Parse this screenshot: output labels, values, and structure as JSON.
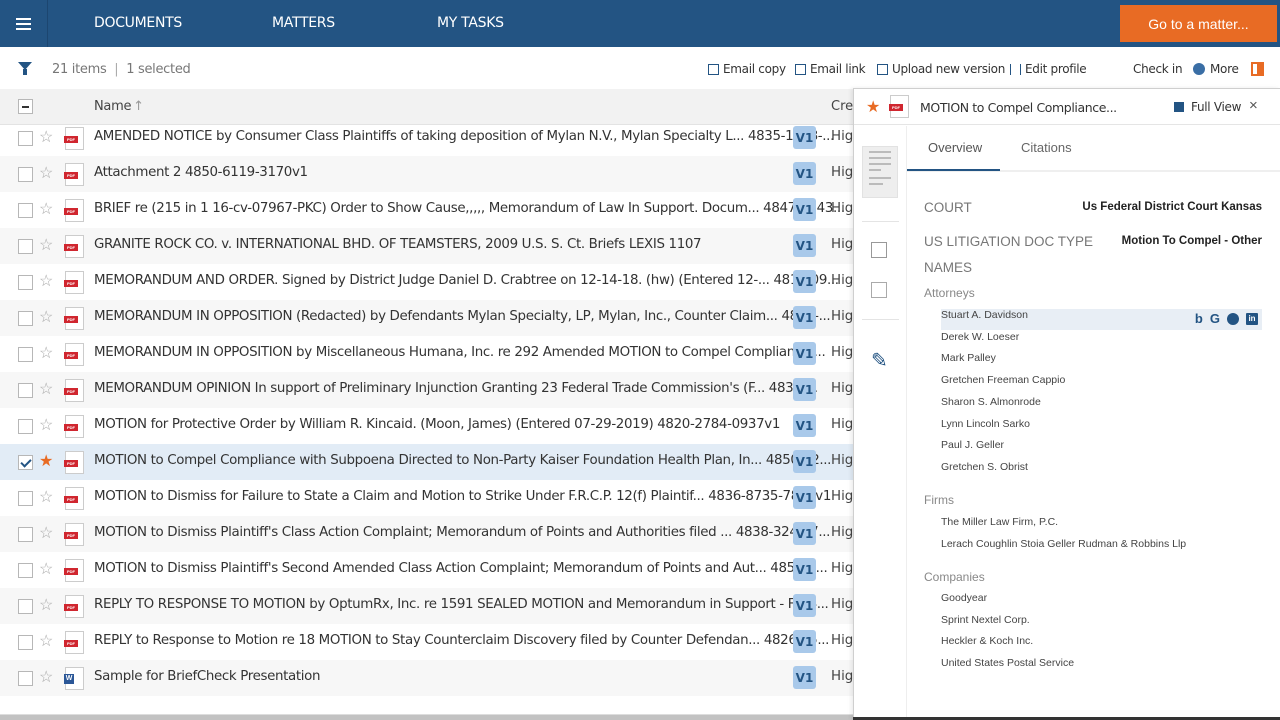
{
  "nav": {
    "menu_icon": "hamburger-icon",
    "links": [
      "DOCUMENTS",
      "MATTERS",
      "MY TASKS"
    ],
    "goto_button": "Go to a matter..."
  },
  "toolbar": {
    "filter_icon": "filter-icon",
    "item_count": "21 items",
    "separator": "|",
    "selected_count": "1 selected",
    "actions": [
      {
        "label": "Email copy",
        "icon": "envelope-icon"
      },
      {
        "label": "Email link",
        "icon": "link-doc-icon"
      },
      {
        "label": "Upload new version",
        "icon": "upload-icon"
      },
      {
        "label": "Edit profile",
        "icon": "edit-profile-icon"
      },
      {
        "label": "Check in",
        "icon": ""
      },
      {
        "label": "More",
        "icon": "more-icon"
      }
    ],
    "panel_toggle_icon": "panel-toggle-icon"
  },
  "table": {
    "columns": {
      "name": "Name",
      "name_sort": "↑",
      "created": "Crea"
    },
    "rows": [
      {
        "title": "AMENDED NOTICE by Consumer Class Plaintiffs of taking deposition of Mylan N.V., Mylan Specialty L... 4835-1488-...",
        "type": "pdf",
        "version": "V1",
        "col": "High",
        "checked": false,
        "starred": false
      },
      {
        "title": "Attachment 2 4850-6119-3170v1",
        "type": "pdf",
        "version": "V1",
        "col": "High",
        "checked": false,
        "starred": false
      },
      {
        "title": "BRIEF re (215 in 1 16-cv-07967-PKC) Order to Show Cause,,,,, Memorandum of Law In Support. Docum... 4847-7143...",
        "type": "pdf",
        "version": "V1",
        "col": "High",
        "checked": false,
        "starred": false
      },
      {
        "title": "GRANITE ROCK CO. v. INTERNATIONAL BHD. OF TEAMSTERS, 2009 U.S. S. Ct. Briefs LEXIS 1107",
        "type": "pdf",
        "version": "V1",
        "col": "High",
        "checked": false,
        "starred": false
      },
      {
        "title": "MEMORANDUM AND ORDER. Signed by District Judge Daniel D. Crabtree on 12-14-18. (hw) (Entered 12-... 4818-09...",
        "type": "pdf",
        "version": "V1",
        "col": "High",
        "checked": false,
        "starred": false
      },
      {
        "title": "MEMORANDUM IN OPPOSITION (Redacted) by Defendants Mylan Specialty, LP, Mylan, Inc., Counter Claim... 4811-...",
        "type": "pdf",
        "version": "V1",
        "col": "High",
        "checked": false,
        "starred": false
      },
      {
        "title": "MEMORANDUM IN OPPOSITION by Miscellaneous Humana, Inc. re 292 Amended MOTION to Compel Complianc......",
        "type": "pdf",
        "version": "V1",
        "col": "High",
        "checked": false,
        "starred": false
      },
      {
        "title": "MEMORANDUM OPINION In support of Preliminary Injunction Granting 23 Federal Trade Commission's (F... 4831-...",
        "type": "pdf",
        "version": "V1",
        "col": "High",
        "checked": false,
        "starred": false
      },
      {
        "title": "MOTION for Protective Order by William R. Kincaid. (Moon, James) (Entered 07-29-2019) 4820-2784-0937v1",
        "type": "pdf",
        "version": "V1",
        "col": "High",
        "checked": false,
        "starred": false
      },
      {
        "title": "MOTION to Compel Compliance with Subpoena Directed to Non-Party Kaiser Foundation Health Plan, In... 4850-92...",
        "type": "pdf",
        "version": "V1",
        "col": "High",
        "checked": true,
        "starred": true
      },
      {
        "title": "MOTION to Dismiss for Failure to State a Claim and Motion to Strike Under F.R.C.P. 12(f) Plaintif... 4836-8735-7857v1",
        "type": "pdf",
        "version": "V1",
        "col": "High",
        "checked": false,
        "starred": false
      },
      {
        "title": "MOTION to Dismiss Plaintiff's Class Action Complaint; Memorandum of Points and Authorities filed ... 4838-3240-7...",
        "type": "pdf",
        "version": "V1",
        "col": "High",
        "checked": false,
        "starred": false
      },
      {
        "title": "MOTION to Dismiss Plaintiff's Second Amended Class Action Complaint; Memorandum of Points and Aut... 4852-4...",
        "type": "pdf",
        "version": "V1",
        "col": "High",
        "checked": false,
        "starred": false
      },
      {
        "title": "REPLY TO RESPONSE TO MOTION by OptumRx, Inc. re 1591 SEALED MOTION and Memorandum in Support - F... 4...",
        "type": "pdf",
        "version": "V1",
        "col": "High",
        "checked": false,
        "starred": false
      },
      {
        "title": "REPLY to Response to Motion re 18 MOTION to Stay Counterclaim Discovery filed by Counter Defendan... 4826-65...",
        "type": "pdf",
        "version": "V1",
        "col": "High",
        "checked": false,
        "starred": false
      },
      {
        "title": "Sample for BriefCheck Presentation",
        "type": "word",
        "version": "V1",
        "col": "High",
        "checked": false,
        "starred": false
      }
    ]
  },
  "panel": {
    "title": "MOTION to Compel Compliance...",
    "full_view": "Full View",
    "close": "×",
    "tabs": [
      "Overview",
      "Citations"
    ],
    "active_tab": "Overview",
    "fields": [
      {
        "label": "COURT",
        "value": "Us Federal District Court Kansas"
      },
      {
        "label": "US LITIGATION DOC TYPE",
        "value": "Motion To Compel - Other"
      }
    ],
    "names_heading": "NAMES",
    "attorneys_heading": "Attorneys",
    "attorneys": [
      "Stuart A. Davidson",
      "Derek W. Loeser",
      "Mark Palley",
      "Gretchen Freeman Cappio",
      "Sharon S. Almonrode",
      "Lynn Lincoln Sarko",
      "Paul J. Geller",
      "Gretchen S. Obrist"
    ],
    "firms_heading": "Firms",
    "firms": [
      "The Miller Law Firm, P.C.",
      "Lerach Coughlin Stoia Geller Rudman & Robbins Llp"
    ],
    "companies_heading": "Companies",
    "companies": [
      "Goodyear",
      "Sprint Nextel Corp.",
      "Heckler & Koch Inc.",
      "United States Postal Service"
    ],
    "search_icons": {
      "bing": "b",
      "google": "G",
      "linkedin": "in"
    }
  },
  "colors": {
    "brand_blue": "#235483",
    "accent_orange": "#e86b24",
    "version_badge": "#a9c9ea",
    "pdf_red": "#d0262f",
    "word_blue": "#2b5797"
  }
}
